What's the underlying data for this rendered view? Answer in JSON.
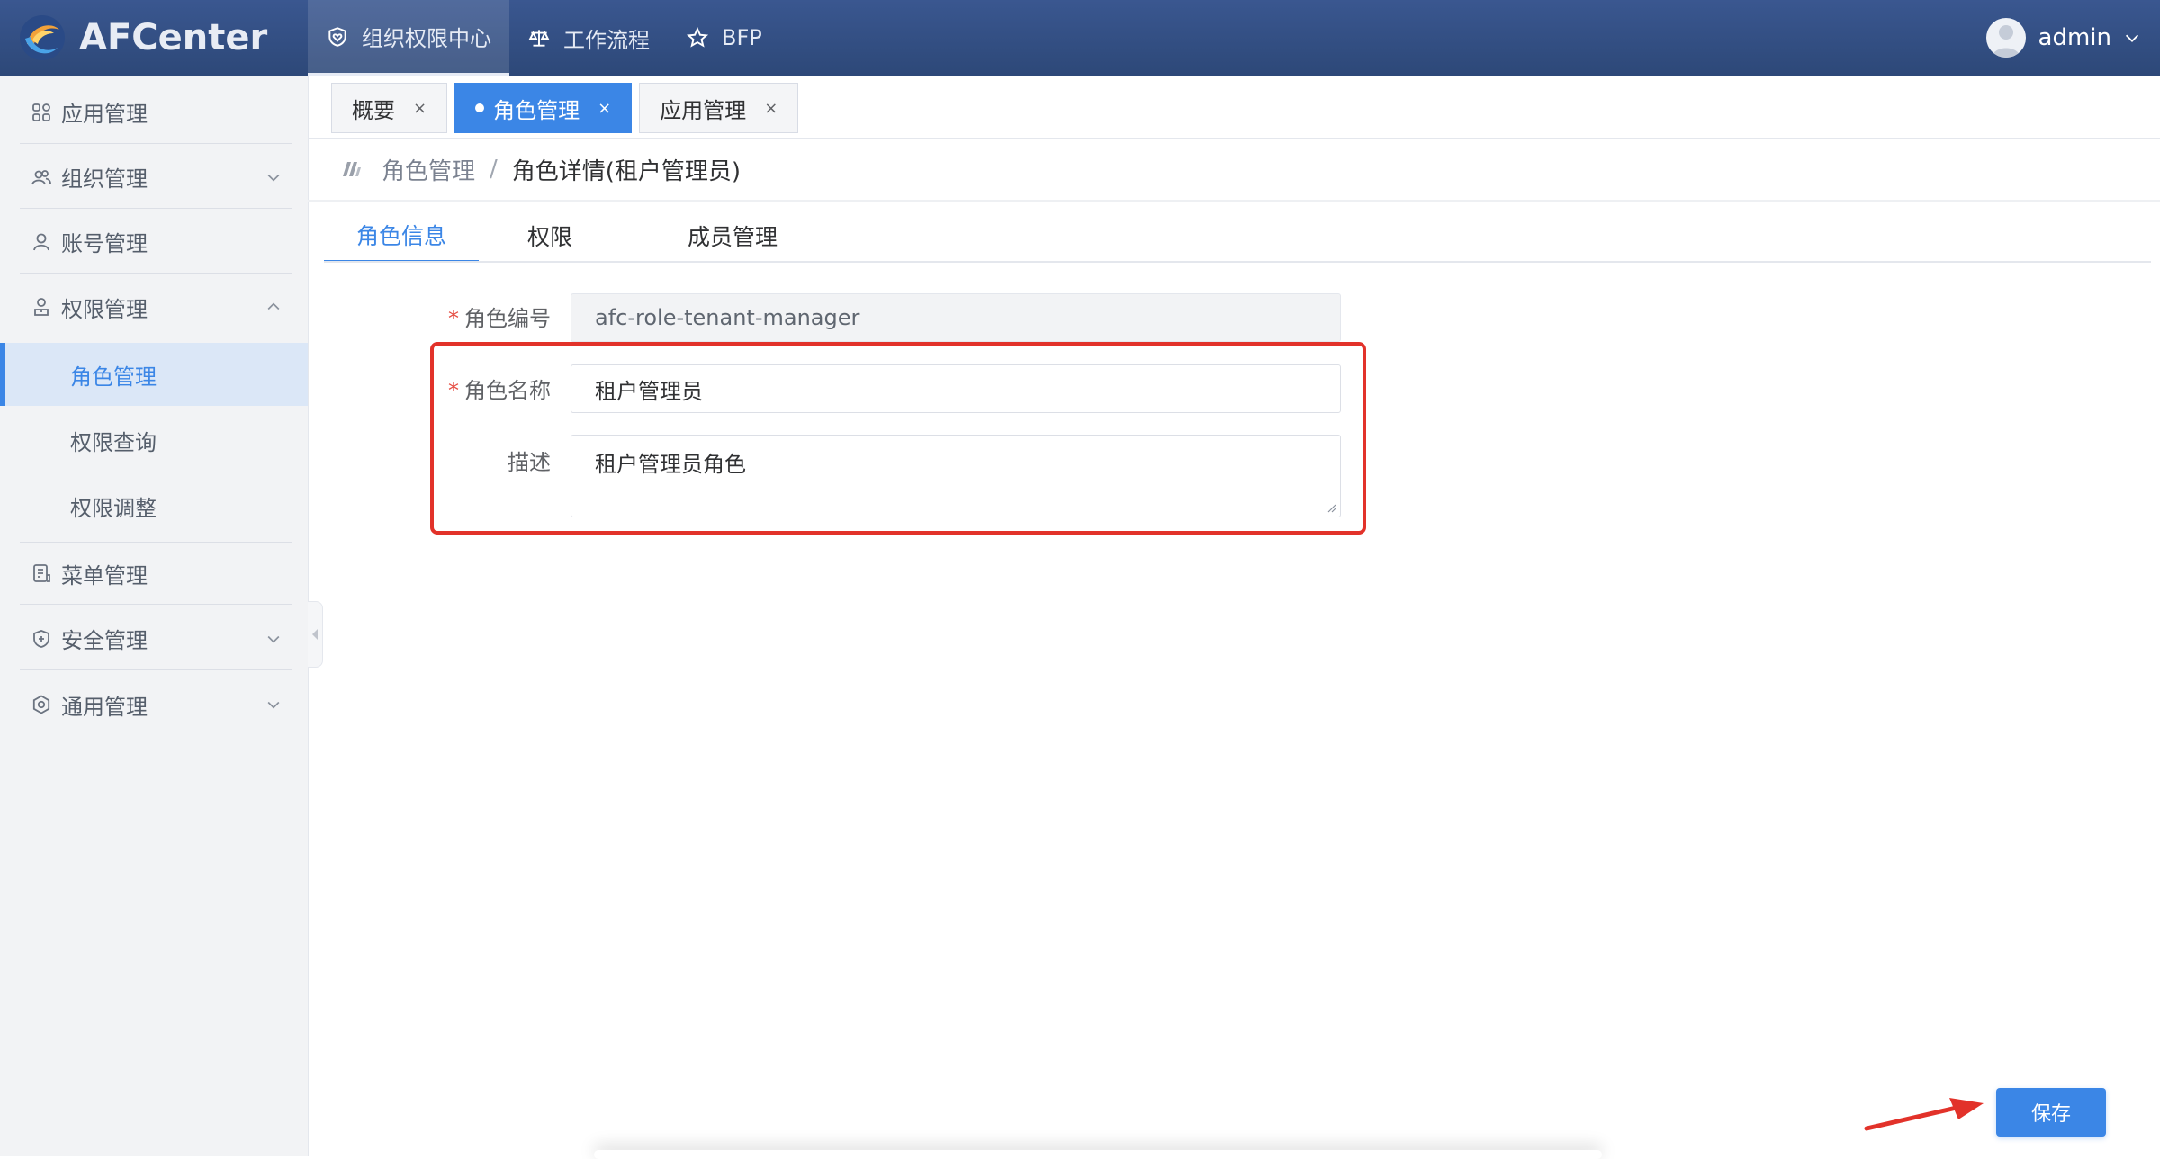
{
  "app": {
    "logo_text": "AFCenter",
    "nav": [
      {
        "label": "组织权限中心",
        "icon": "heart-shield-icon",
        "active": true
      },
      {
        "label": "工作流程",
        "icon": "scale-icon",
        "active": false
      },
      {
        "label": "BFP",
        "icon": "star-icon",
        "active": false
      }
    ],
    "user": {
      "name": "admin",
      "icon": "avatar-icon"
    }
  },
  "sidebar": {
    "items": [
      {
        "label": "应用管理",
        "icon": "grid-icon",
        "expandable": false
      },
      {
        "label": "组织管理",
        "icon": "users-icon",
        "expandable": true,
        "expanded": false
      },
      {
        "label": "账号管理",
        "icon": "user-icon",
        "expandable": false
      },
      {
        "label": "权限管理",
        "icon": "user-lock-icon",
        "expandable": true,
        "expanded": true
      },
      {
        "label": "菜单管理",
        "icon": "menu-doc-icon",
        "expandable": false
      },
      {
        "label": "安全管理",
        "icon": "shield-plus-icon",
        "expandable": true,
        "expanded": false
      },
      {
        "label": "通用管理",
        "icon": "gear-icon",
        "expandable": true,
        "expanded": false
      }
    ],
    "sub_items": [
      {
        "label": "角色管理",
        "active": true
      },
      {
        "label": "权限查询",
        "active": false
      },
      {
        "label": "权限调整",
        "active": false
      }
    ]
  },
  "tabs": [
    {
      "label": "概要",
      "active": false,
      "close": "×"
    },
    {
      "label": "角色管理",
      "active": true,
      "close": "×"
    },
    {
      "label": "应用管理",
      "active": false,
      "close": "×"
    }
  ],
  "breadcrumb": {
    "parent": "角色管理",
    "separator": "/",
    "current": "角色详情(租户管理员)"
  },
  "content_tabs": [
    {
      "label": "角色信息",
      "active": true
    },
    {
      "label": "权限",
      "active": false
    },
    {
      "label": "成员管理",
      "active": false
    }
  ],
  "form": {
    "role_code": {
      "label": "角色编号",
      "required": "*",
      "value": "afc-role-tenant-manager"
    },
    "role_name": {
      "label": "角色名称",
      "required": "*",
      "value": "租户管理员"
    },
    "description": {
      "label": "描述",
      "value": "租户管理员角色"
    }
  },
  "actions": {
    "save_label": "保存"
  },
  "colors": {
    "primary": "#3b86e6",
    "header": "#2d4878",
    "highlight": "#e2322a",
    "required": "#e54d42"
  }
}
